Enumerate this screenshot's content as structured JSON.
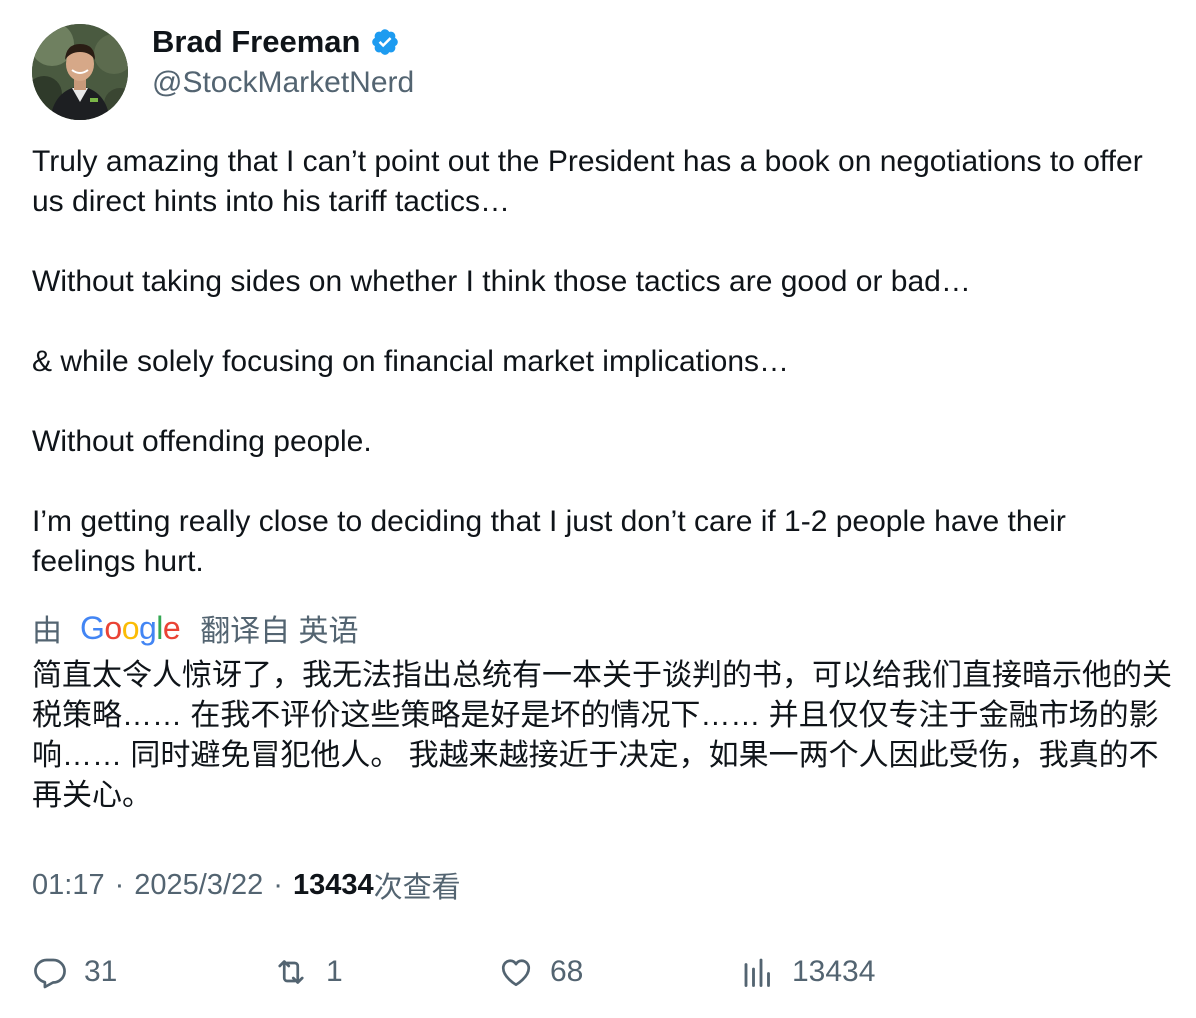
{
  "author": {
    "display_name": "Brad Freeman",
    "handle": "@StockMarketNerd",
    "verified": true,
    "avatar_icon": "avatar-photo"
  },
  "tweet": {
    "paragraphs": [
      "Truly amazing that I can’t point out the President has a book on negotiations to offer us direct hints into his tariff tactics…",
      "Without taking sides on whether I think those tactics are good or bad…",
      "& while solely focusing on financial market implications…",
      "Without offending people.",
      "I’m getting really close to deciding that I just don’t care if 1-2 people have their feelings hurt."
    ]
  },
  "translation": {
    "by_label": "由",
    "provider": "Google",
    "from_label": "翻译自 英语",
    "text": "简直太令人惊讶了，我无法指出总统有一本关于谈判的书，可以给我们直接暗示他的关税策略…… 在我不评价这些策略是好是坏的情况下…… 并且仅仅专注于金融市场的影响…… 同时避免冒犯他人。 我越来越接近于决定，如果一两个人因此受伤，我真的不再关心。"
  },
  "meta": {
    "time": "01:17",
    "separator": "·",
    "date": "2025/3/22",
    "views_count": "13434",
    "views_label": "次查看"
  },
  "actions": {
    "replies": "31",
    "retweets": "1",
    "likes": "68",
    "views": "13434"
  },
  "colors": {
    "text_primary": "#0f1419",
    "text_secondary": "#536471",
    "verified_blue": "#1d9bf0",
    "google_blue": "#4285F4",
    "google_red": "#EA4335",
    "google_yellow": "#FBBC05",
    "google_green": "#34A853"
  }
}
